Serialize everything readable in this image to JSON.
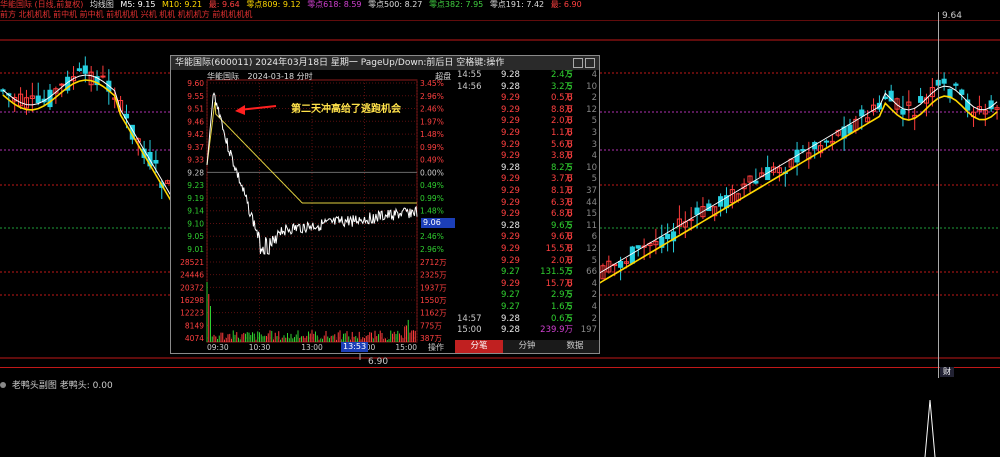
{
  "topbar": {
    "title": "华能国际 (日线,前复权)",
    "indicator": "均线图",
    "m5": "M5: 9.15",
    "m10": "M10: 9.21",
    "extra1": "最: 9.64",
    "z809": "零点809: 9.12",
    "z618": "零点618: 8.59",
    "z500": "零点500: 8.27",
    "z382": "零点382: 7.95",
    "z191": "零点191: 7.42",
    "last": "最: 6.90"
  },
  "subbar": "前方 北机机机 前中机 前中机 前机机机 兴机 机机 机机机方 前机机机机",
  "main": {
    "price_high_label": "9.64",
    "price_low_label": "6.90",
    "cross_label": "财",
    "levels_colors": {
      "red": "#c01818",
      "magenta": "#b030b0",
      "green": "#1e9e3a",
      "yellow": "#d8c020"
    }
  },
  "indicator": {
    "name": "老鸭头副图",
    "value": "老鸭头: 0.00"
  },
  "popup": {
    "title": "华能国际(600011)  2024年03月18日  星期一  PageUp/Down:前后日  空格键:操作",
    "chart_title": "华能国际",
    "chart_date": "2024-03-18 分时",
    "chart_button": "超盘",
    "annotation": "第二天冲高给了逃跑机会",
    "current_price": "9.06",
    "current_time": "13:53",
    "op_label": "操作",
    "price_labels": [
      "9.60",
      "9.55",
      "9.51",
      "9.46",
      "9.42",
      "9.37",
      "9.33",
      "9.28",
      "9.23",
      "9.19",
      "9.14",
      "9.10",
      "9.05",
      "9.01"
    ],
    "pct_labels": [
      "3.45%",
      "2.96%",
      "2.46%",
      "1.97%",
      "1.48%",
      "0.99%",
      "0.49%",
      "0.00%",
      "0.49%",
      "0.99%",
      "1.48%",
      "1.97%",
      "2.46%",
      "2.96%"
    ],
    "vol_labels_left": [
      "28521",
      "24446",
      "20372",
      "16298",
      "12223",
      "8149",
      "4074"
    ],
    "vol_labels_right": [
      "2712万",
      "2325万",
      "1937万",
      "1550万",
      "1162万",
      "775万",
      "387万"
    ],
    "time_labels": [
      "09:30",
      "10:30",
      "13:00",
      "14:00",
      "15:00"
    ],
    "ticks": [
      {
        "time": "14:55",
        "price": "9.28",
        "vol": "2.4万",
        "side": "S",
        "num": "4"
      },
      {
        "time": "14:56",
        "price": "9.28",
        "vol": "3.2万",
        "side": "S",
        "num": "10"
      },
      {
        "time": "",
        "price": "9.29",
        "vol": "0.5万",
        "side": "B",
        "num": "2"
      },
      {
        "time": "",
        "price": "9.29",
        "vol": "8.8万",
        "side": "B",
        "num": "12"
      },
      {
        "time": "",
        "price": "9.29",
        "vol": "2.0万",
        "side": "B",
        "num": "5"
      },
      {
        "time": "",
        "price": "9.29",
        "vol": "1.1万",
        "side": "B",
        "num": "3"
      },
      {
        "time": "",
        "price": "9.29",
        "vol": "5.6万",
        "side": "B",
        "num": "3"
      },
      {
        "time": "",
        "price": "9.29",
        "vol": "3.8万",
        "side": "B",
        "num": "4"
      },
      {
        "time": "",
        "price": "9.28",
        "vol": "8.2万",
        "side": "S",
        "num": "10"
      },
      {
        "time": "",
        "price": "9.29",
        "vol": "3.7万",
        "side": "B",
        "num": "5"
      },
      {
        "time": "",
        "price": "9.29",
        "vol": "8.1万",
        "side": "B",
        "num": "37"
      },
      {
        "time": "",
        "price": "9.29",
        "vol": "6.3万",
        "side": "B",
        "num": "44"
      },
      {
        "time": "",
        "price": "9.29",
        "vol": "6.8万",
        "side": "B",
        "num": "15"
      },
      {
        "time": "",
        "price": "9.28",
        "vol": "9.6万",
        "side": "S",
        "num": "11"
      },
      {
        "time": "",
        "price": "9.29",
        "vol": "9.6万",
        "side": "B",
        "num": "6"
      },
      {
        "time": "",
        "price": "9.29",
        "vol": "15.5万",
        "side": "B",
        "num": "12"
      },
      {
        "time": "",
        "price": "9.29",
        "vol": "2.0万",
        "side": "B",
        "num": "5"
      },
      {
        "time": "",
        "price": "9.27",
        "vol": "131.5万",
        "side": "S",
        "num": "66"
      },
      {
        "time": "",
        "price": "9.29",
        "vol": "15.7万",
        "side": "B",
        "num": "4"
      },
      {
        "time": "",
        "price": "9.27",
        "vol": "2.9万",
        "side": "S",
        "num": "2"
      },
      {
        "time": "",
        "price": "9.27",
        "vol": "1.6万",
        "side": "S",
        "num": "4"
      },
      {
        "time": "14:57",
        "price": "9.28",
        "vol": "0.6万",
        "side": "S",
        "num": "2"
      },
      {
        "time": "15:00",
        "price": "9.28",
        "vol": "239.9万",
        "side": "",
        "num": "197"
      }
    ],
    "tabs": [
      "分笔",
      "分钟",
      "数据"
    ]
  }
}
